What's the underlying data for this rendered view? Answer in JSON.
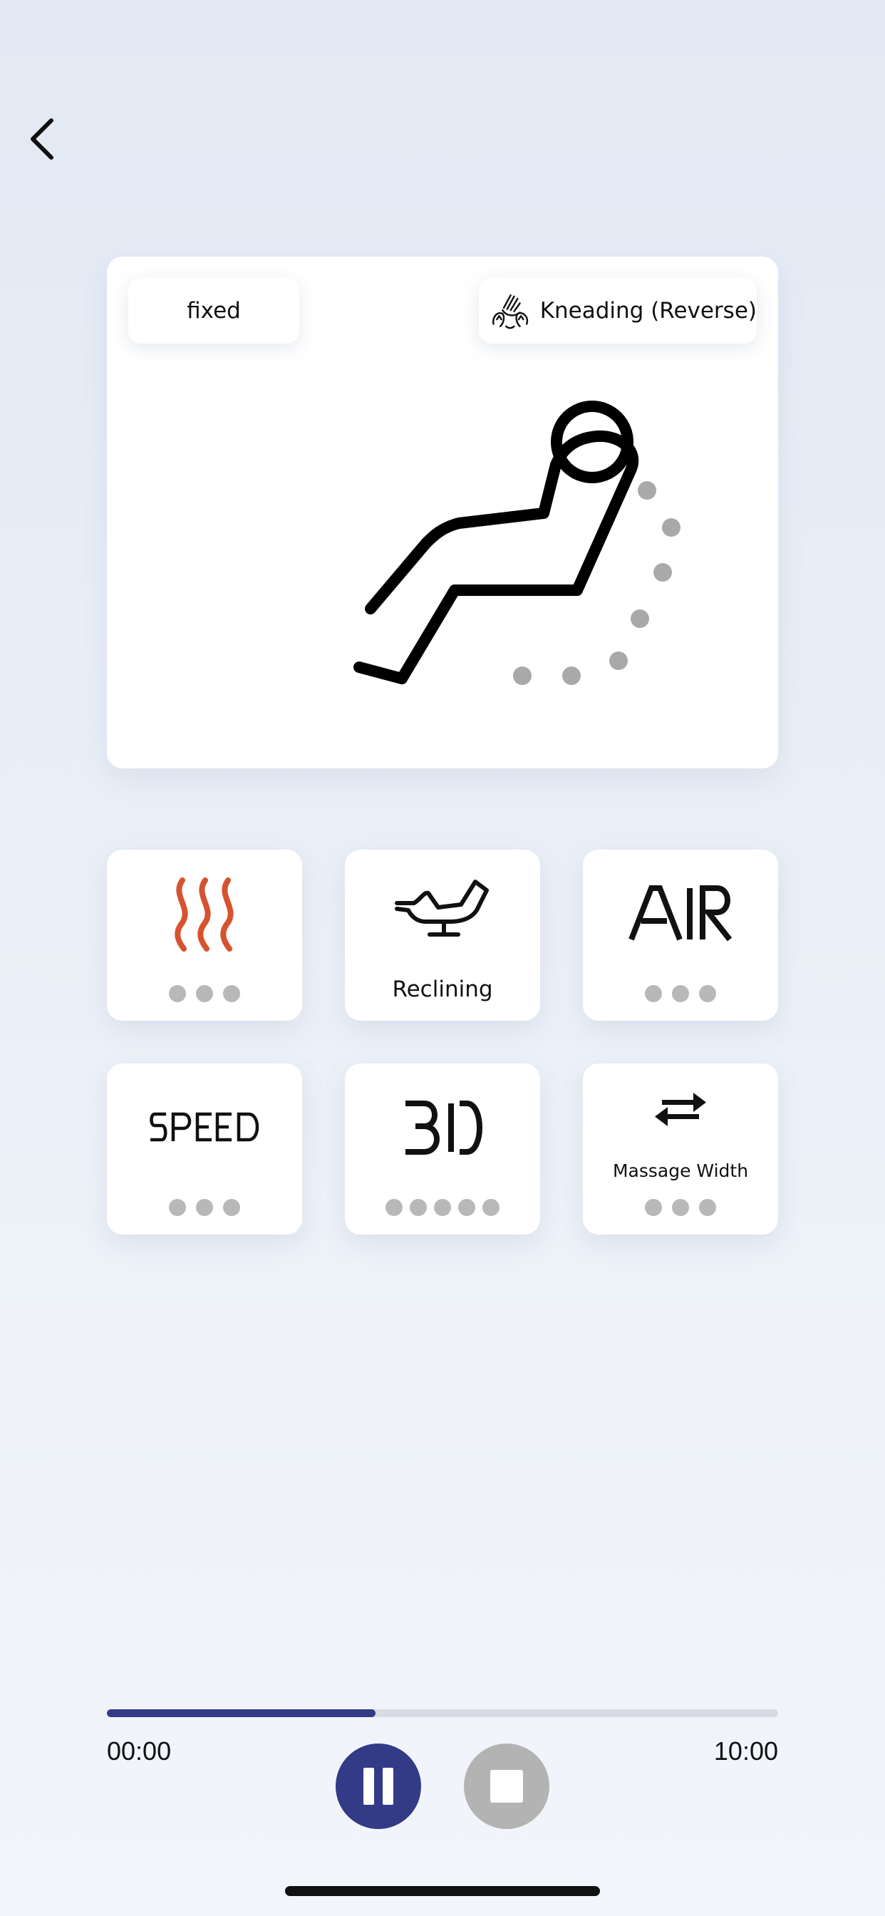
{
  "header": {
    "back_icon": "chevron-left-icon"
  },
  "hero": {
    "mode_label": "fixed",
    "technique_label": "Kneading (Reverse)",
    "technique_icon": "kneading-hand-icon"
  },
  "tiles": [
    {
      "name": "heat",
      "icon": "heat-waves-icon",
      "levels": 3,
      "icon_color": "#d6532f"
    },
    {
      "name": "reclining",
      "icon": "recline-chair-icon",
      "label": "Reclining"
    },
    {
      "name": "air",
      "icon": "air-icon",
      "icon_text": "AIR",
      "levels": 3
    },
    {
      "name": "speed",
      "icon": "speed-icon",
      "icon_text": "SPEED",
      "levels": 3
    },
    {
      "name": "3d",
      "icon": "3d-icon",
      "icon_text": "3D",
      "levels": 5
    },
    {
      "name": "massage-width",
      "icon": "swap-arrows-icon",
      "label": "Massage Width",
      "levels": 3
    }
  ],
  "player": {
    "progress_fraction": 0.4,
    "elapsed": "00:00",
    "total": "10:00",
    "pause_icon": "pause-icon",
    "stop_icon": "stop-icon",
    "accent_color": "#333a86"
  }
}
